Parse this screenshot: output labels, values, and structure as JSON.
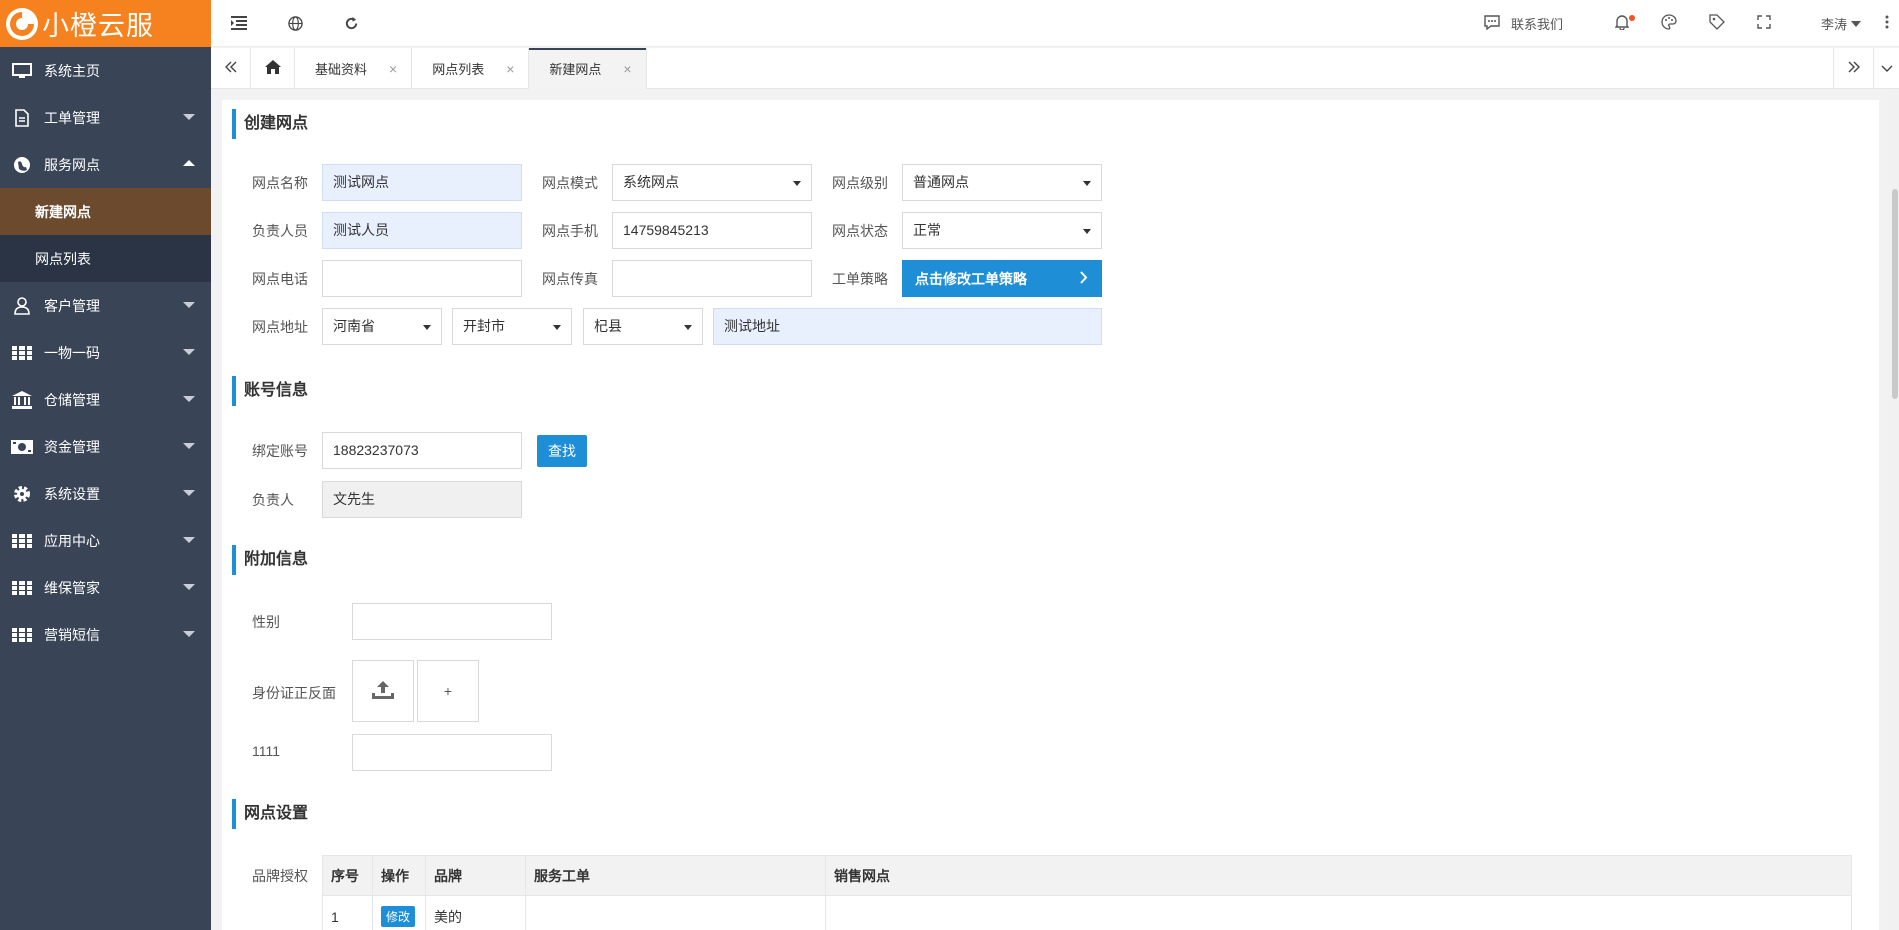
{
  "app": {
    "logo_text": "小橙云服"
  },
  "sidebar": {
    "items": [
      {
        "label": "系统主页"
      },
      {
        "label": "工单管理"
      },
      {
        "label": "服务网点"
      },
      {
        "label": "客户管理"
      },
      {
        "label": "一物一码"
      },
      {
        "label": "仓储管理"
      },
      {
        "label": "资金管理"
      },
      {
        "label": "系统设置"
      },
      {
        "label": "应用中心"
      },
      {
        "label": "维保管家"
      },
      {
        "label": "营销短信"
      }
    ],
    "sub_items": [
      {
        "label": "新建网点"
      },
      {
        "label": "网点列表"
      }
    ]
  },
  "topbar": {
    "contact_label": "联系我们",
    "user_name": "李涛"
  },
  "tabs": [
    {
      "label": "基础资料"
    },
    {
      "label": "网点列表"
    },
    {
      "label": "新建网点"
    }
  ],
  "tab_close": "×",
  "sections": {
    "create": {
      "title": "创建网点",
      "name_label": "网点名称",
      "name_value": "测试网点",
      "mode_label": "网点模式",
      "mode_value": "系统网点",
      "level_label": "网点级别",
      "level_value": "普通网点",
      "owner_label": "负责人员",
      "owner_value": "测试人员",
      "mobile_label": "网点手机",
      "mobile_value": "14759845213",
      "status_label": "网点状态",
      "status_value": "正常",
      "phone_label": "网点电话",
      "phone_value": "",
      "fax_label": "网点传真",
      "fax_value": "",
      "strategy_label": "工单策略",
      "strategy_button": "点击修改工单策略",
      "address_label": "网点地址",
      "province": "河南省",
      "city": "开封市",
      "county": "杞县",
      "address_detail": "测试地址"
    },
    "account": {
      "title": "账号信息",
      "bind_label": "绑定账号",
      "bind_value": "18823237073",
      "search_button": "查找",
      "owner_label": "负责人",
      "owner_value": "文先生"
    },
    "extra": {
      "title": "附加信息",
      "gender_label": "性别",
      "gender_value": "",
      "id_label": "身份证正反面",
      "plus": "+",
      "custom_label": "1111",
      "custom_value": ""
    },
    "settings": {
      "title": "网点设置",
      "brand_label": "品牌授权",
      "columns": [
        "序号",
        "操作",
        "品牌",
        "服务工单",
        "销售网点"
      ],
      "rows": [
        {
          "index": "1",
          "action": "修改",
          "brand": "美的",
          "service": "",
          "sales": ""
        }
      ]
    }
  },
  "colors": {
    "brand_orange": "#f5821f",
    "sidebar": "#3a4457",
    "accent_blue": "#1e8ed6"
  }
}
